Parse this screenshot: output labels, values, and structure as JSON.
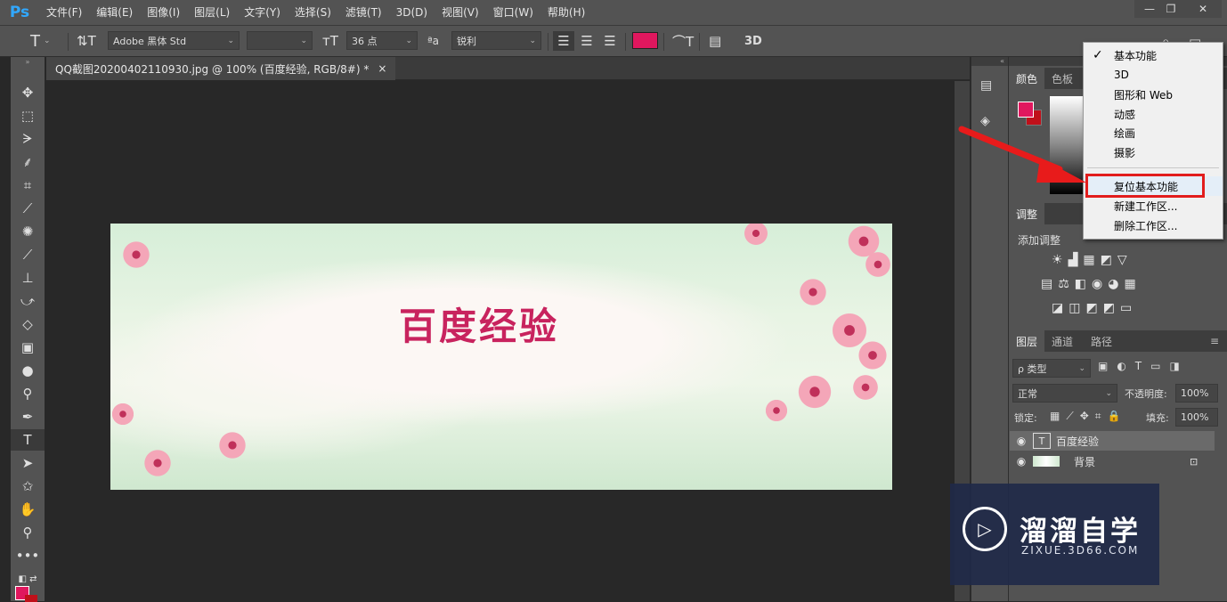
{
  "app": {
    "logo": "Ps"
  },
  "menubar": {
    "items": [
      "文件(F)",
      "编辑(E)",
      "图像(I)",
      "图层(L)",
      "文字(Y)",
      "选择(S)",
      "滤镜(T)",
      "3D(D)",
      "视图(V)",
      "窗口(W)",
      "帮助(H)"
    ]
  },
  "window_controls": {
    "minimize": "—",
    "restore": "❐",
    "close": "✕"
  },
  "options": {
    "tool_glyph": "T",
    "orient_glyph": "⇅T",
    "font_family": "Adobe 黑体 Std",
    "font_style": "",
    "size_glyph": "тT",
    "font_size": "36 点",
    "aa_glyph": "ªa",
    "antialias": "锐利",
    "text_color": "#e0175e",
    "warp_glyph": "⌒T",
    "panel_glyph": "▤",
    "threed": "3D"
  },
  "document": {
    "tab_title": "QQ截图20200402110930.jpg @ 100% (百度经验, RGB/8#) *",
    "close": "×",
    "image_text": "百度经验"
  },
  "workspace_menu": {
    "items": [
      "基本功能",
      "3D",
      "图形和 Web",
      "动感",
      "绘画",
      "摄影"
    ],
    "checked_index": 0,
    "check": "✓",
    "actions": [
      "复位基本功能",
      "新建工作区...",
      "删除工作区..."
    ]
  },
  "panels": {
    "color_tabs": [
      "颜色",
      "色板"
    ],
    "adjust": {
      "tab": "调整",
      "heading": "添加调整",
      "row1": [
        "☀",
        "▟",
        "▦",
        "◩",
        "▽"
      ],
      "row2": [
        "▤",
        "⚖",
        "◧",
        "◉",
        "◕",
        "▦"
      ],
      "row3": [
        "◪",
        "◫",
        "◩",
        "◩",
        "▭"
      ]
    },
    "layers_tabs": [
      "图层",
      "通道",
      "路径"
    ],
    "filter_label": "ρ 类型",
    "blend_mode": "正常",
    "opacity_label": "不透明度:",
    "opacity": "100%",
    "lock_label": "锁定:",
    "fill_label": "填充:",
    "fill": "100%",
    "layers": [
      {
        "name": "百度经验",
        "type": "T"
      },
      {
        "name": "背景",
        "type": "image"
      }
    ],
    "lock_icon": "🔒",
    "eye": "👁",
    "menu_glyph": "≡"
  },
  "watermark": {
    "title": "溜溜自学",
    "url": "ZIXUE.3D66.COM"
  }
}
